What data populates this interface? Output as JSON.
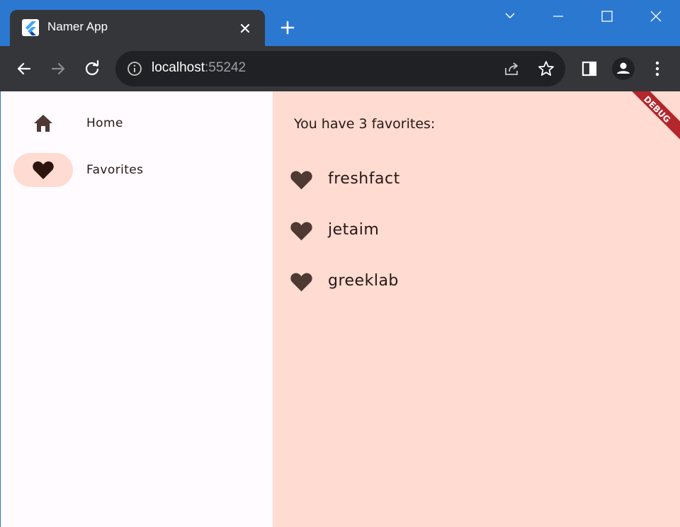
{
  "browser": {
    "tab_title": "Namer App",
    "url_host": "localhost",
    "url_port": ":55242",
    "icons": {
      "favicon": "flutter-logo-icon",
      "close_tab": "close-icon",
      "new_tab": "plus-icon",
      "back": "arrow-left-icon",
      "forward": "arrow-right-icon",
      "reload": "reload-icon",
      "site_info": "info-icon",
      "share": "share-icon",
      "bookmark": "star-icon",
      "side_panel": "side-panel-icon",
      "profile": "profile-icon",
      "menu": "kebab-menu-icon"
    },
    "colors": {
      "title_bar": "#2a78d0",
      "tab": "#35363a",
      "omnibox": "#202124"
    }
  },
  "app": {
    "navigation": {
      "items": [
        {
          "label": "Home",
          "icon": "home-icon",
          "selected": false
        },
        {
          "label": "Favorites",
          "icon": "heart-icon",
          "selected": true
        }
      ]
    },
    "favorites": {
      "header": "You have 3 favorites:",
      "items": [
        "freshfact",
        "jetaim",
        "greeklab"
      ],
      "icon": "heart-icon"
    },
    "debug_banner": "DEBUG",
    "colors": {
      "rail_background": "#fffbfe",
      "main_background": "#ffdbd1",
      "selected_indicator": "#ffdbd1",
      "icon": "#4e3933",
      "selected_icon": "#2c150f",
      "text": "#261816",
      "debug_banner": "#b3262b"
    }
  }
}
